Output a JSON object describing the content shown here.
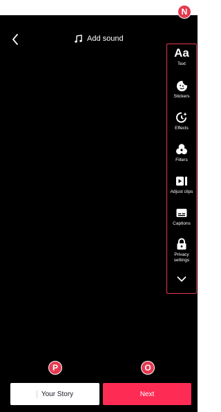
{
  "header": {
    "back_icon": "chevron-left-icon",
    "add_sound_label": "Add sound",
    "music_icon": "music-note-icon"
  },
  "toolbar": {
    "items": [
      {
        "label": "Text",
        "icon": "text-aa-icon",
        "glyph": "Aa"
      },
      {
        "label": "Stickers",
        "icon": "sticker-icon"
      },
      {
        "label": "Effects",
        "icon": "effects-icon"
      },
      {
        "label": "Filters",
        "icon": "filters-icon"
      },
      {
        "label": "Adjust clips",
        "icon": "adjust-clips-icon"
      },
      {
        "label": "Captions",
        "icon": "captions-icon"
      },
      {
        "label": "Privacy settings",
        "icon": "lock-icon"
      }
    ],
    "more_icon": "chevron-down-icon"
  },
  "markers": {
    "n": "N",
    "p": "P",
    "o": "O"
  },
  "footer": {
    "your_story_label": "Your Story",
    "next_label": "Next"
  },
  "colors": {
    "accent": "#fe2c55",
    "marker": "#e53950",
    "background": "#000000"
  }
}
